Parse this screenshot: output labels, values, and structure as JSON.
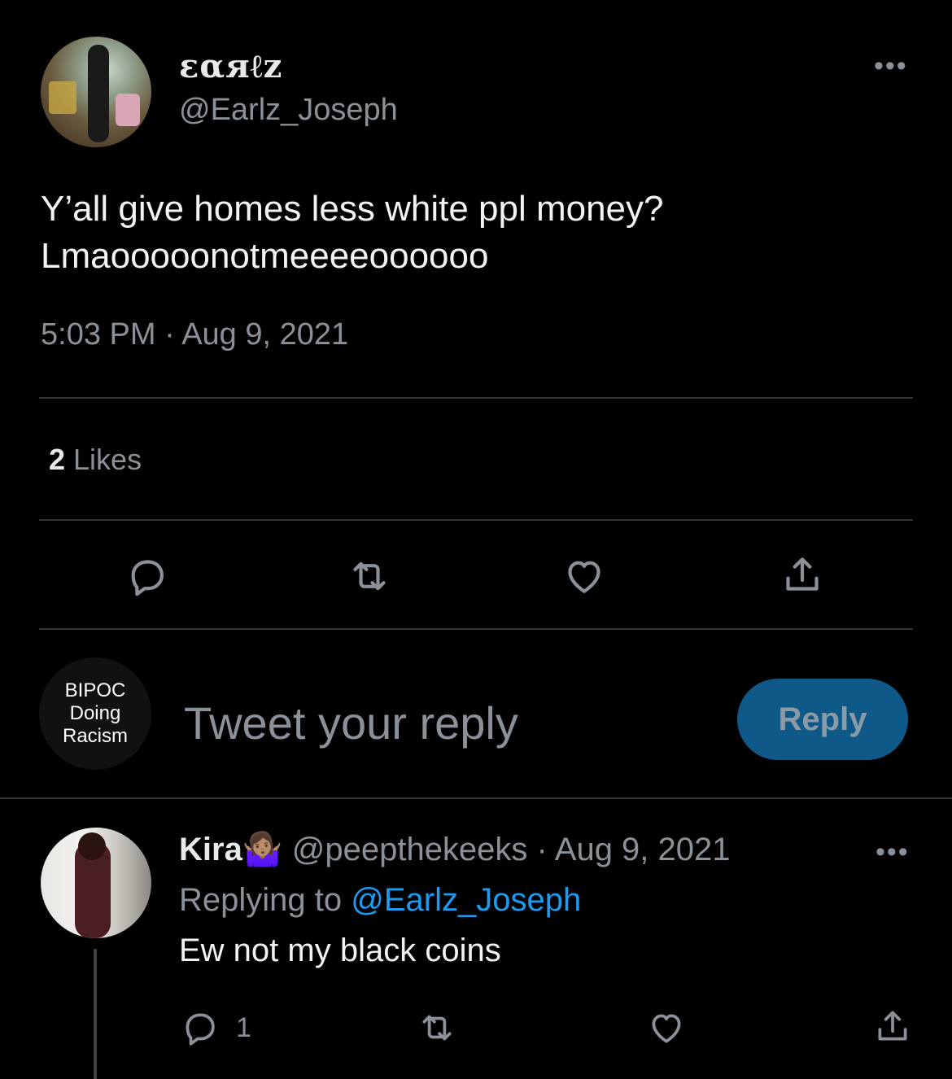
{
  "tweet": {
    "display_name": "εαяℓz",
    "handle": "@Earlz_Joseph",
    "text_line1": "Y’all give homes less white ppl money?",
    "text_line2": "Lmaooooonotmeeeeoooooo",
    "timestamp": "5:03 PM · Aug 9, 2021",
    "likes_count": "2",
    "likes_label": " Likes",
    "more_label": "•••"
  },
  "compose": {
    "avatar_text_1": "BIPOC",
    "avatar_text_2": "Doing",
    "avatar_text_3": "Racism",
    "placeholder": "Tweet your reply",
    "reply_button": "Reply"
  },
  "reply": {
    "name": "Kira",
    "emoji": "🤷🏽‍♀️",
    "meta": " @peepthekeeks · Aug 9, 2021",
    "replying_prefix": "Replying to ",
    "replying_handle": "@Earlz_Joseph",
    "text": "Ew not my black coins",
    "reply_count": "1",
    "more_label": "•••"
  },
  "icons": [
    "reply-icon",
    "retweet-icon",
    "like-icon",
    "share-icon",
    "more-icon"
  ]
}
